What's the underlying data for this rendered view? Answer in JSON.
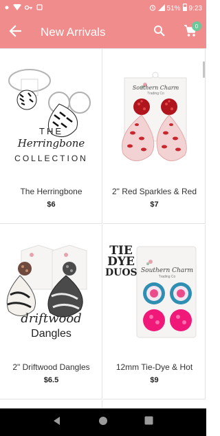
{
  "status_bar": {
    "battery": "51%",
    "time": "9:23"
  },
  "app_bar": {
    "title": "New Arrivals",
    "cart_count": "0"
  },
  "products": [
    {
      "name": "The Herringbone",
      "price": "$6",
      "image_text": [
        "THE",
        "Herringbone",
        "COLLECTION"
      ]
    },
    {
      "name": "2\" Red Sparkles & Red",
      "price": "$7",
      "image_text": [
        "Southern Charm",
        "Trading Co"
      ]
    },
    {
      "name": "2\" Driftwood Dangles",
      "price": "$6.5",
      "image_text": [
        "driftwood",
        "Dangles"
      ]
    },
    {
      "name": "12mm Tie-Dye & Hot",
      "price": "$9",
      "image_text": [
        "TIE",
        "DYE",
        "DUOS",
        "Southern Charm",
        "Trading Co"
      ]
    }
  ],
  "colors": {
    "accent": "#f08c8c",
    "badge": "#6cc79a",
    "nav_bar": "#000000"
  },
  "icons": [
    "wifi-icon",
    "vpn-key-icon",
    "alarm-icon",
    "battery-icon",
    "back-arrow-icon",
    "search-icon",
    "cart-icon",
    "nav-back-icon",
    "nav-home-icon",
    "nav-recents-icon"
  ]
}
